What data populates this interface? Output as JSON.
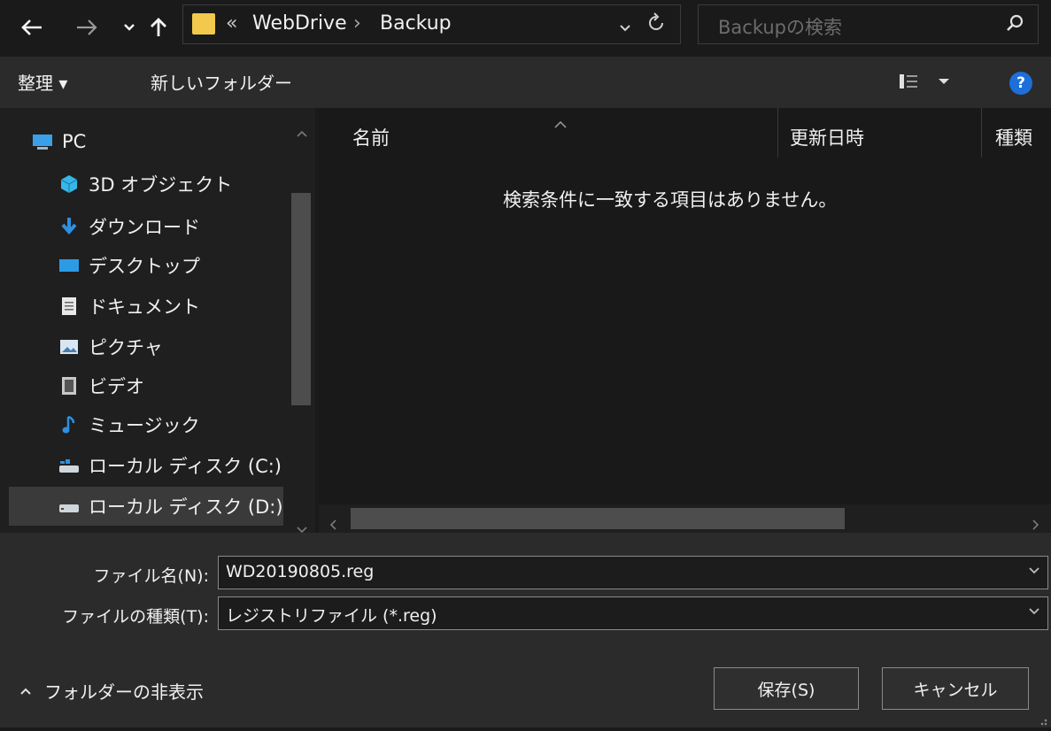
{
  "address": {
    "path_overflow": "«",
    "path_parent": "WebDrive",
    "path_separator": "›",
    "path_current": "Backup",
    "search_placeholder": "Backupの検索"
  },
  "toolbar": {
    "organize_label": "整理 ▾",
    "new_folder_label": "新しいフォルダー"
  },
  "nav": {
    "items": [
      {
        "label": "PC",
        "icon": "pc-icon"
      },
      {
        "label": "3D オブジェクト",
        "icon": "3d-objects-icon"
      },
      {
        "label": "ダウンロード",
        "icon": "download-icon"
      },
      {
        "label": "デスクトップ",
        "icon": "desktop-icon"
      },
      {
        "label": "ドキュメント",
        "icon": "documents-icon"
      },
      {
        "label": "ピクチャ",
        "icon": "pictures-icon"
      },
      {
        "label": "ビデオ",
        "icon": "video-icon"
      },
      {
        "label": "ミュージック",
        "icon": "music-icon"
      },
      {
        "label": "ローカル ディスク (C:)",
        "icon": "local-disk-c-icon"
      },
      {
        "label": "ローカル ディスク (D:)",
        "icon": "local-disk-d-icon"
      }
    ],
    "selected_index": 9
  },
  "content": {
    "columns": [
      "名前",
      "更新日時",
      "種類"
    ],
    "empty_message": "検索条件に一致する項目はありません。"
  },
  "form": {
    "filename_label": "ファイル名(N):",
    "filename_value": "WD20190805.reg",
    "filetype_label": "ファイルの種類(T):",
    "filetype_value": "レジストリファイル (*.reg)"
  },
  "footer": {
    "hide_folders_label": "フォルダーの非表示",
    "save_label": "保存(S)",
    "cancel_label": "キャンセル"
  },
  "colors": {
    "accent": "#1e6fd9",
    "folder": "#f2c94c"
  }
}
